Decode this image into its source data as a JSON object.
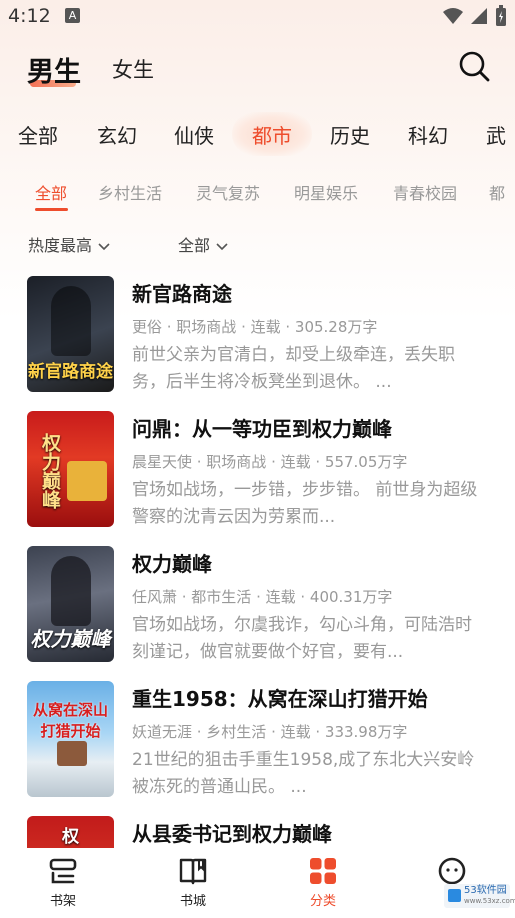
{
  "status_bar": {
    "time": "4:12",
    "notification_letter": "A"
  },
  "gender_tabs": {
    "active": "男生",
    "inactive": "女生"
  },
  "genres": [
    "全部",
    "玄幻",
    "仙侠",
    "都市",
    "历史",
    "科幻",
    "武"
  ],
  "active_genre": "都市",
  "sub_genres": [
    "全部",
    "乡村生活",
    "灵气复苏",
    "明星娱乐",
    "青春校园",
    "都"
  ],
  "active_sub_genre": "全部",
  "filters": {
    "sort": "热度最高",
    "status": "全部"
  },
  "books": [
    {
      "title": "新官路商途",
      "meta": "更俗 · 职场商战 · 连载 · 305.28万字",
      "desc": "前世父亲为官清白，却受上级牵连，丢失职务，后半生将冷板凳坐到退休。 ...",
      "cover_text": "新官路商途"
    },
    {
      "title": "问鼎：从一等功臣到权力巅峰",
      "meta": "晨星天使 · 职场商战 · 连载 · 557.05万字",
      "desc": "官场如战场，一步错，步步错。 前世身为超级警察的沈青云因为劳累而...",
      "cover_text": "权力巅峰"
    },
    {
      "title": "权力巅峰",
      "meta": "任风萧 · 都市生活 · 连载 · 400.31万字",
      "desc": "官场如战场，尔虞我诈，勾心斗角，可陆浩时刻谨记，做官就要做个好官，要有...",
      "cover_text": "权力巅峰"
    },
    {
      "title": "重生1958：从窝在深山打猎开始",
      "meta": "妖道无涯 · 乡村生活 · 连载 · 333.98万字",
      "desc": "21世纪的狙击手重生1958,成了东北大兴安岭被冻死的普通山民。 ...",
      "cover_text": "从窝在深山打猎开始"
    },
    {
      "title": "从县委书记到权力巅峰",
      "meta": "",
      "desc": "",
      "cover_text": "权"
    }
  ],
  "tabs": [
    {
      "label": "书架",
      "icon": "bookshelf-icon"
    },
    {
      "label": "书城",
      "icon": "book-open-icon"
    },
    {
      "label": "分类",
      "icon": "grid-icon"
    },
    {
      "label": "",
      "icon": "profile-icon"
    }
  ],
  "active_tab": "分类",
  "watermark": {
    "line1": "53软件园",
    "line2": "www.53xz.com"
  },
  "colors": {
    "accent": "#ee4d2d",
    "muted_text": "#999999"
  }
}
